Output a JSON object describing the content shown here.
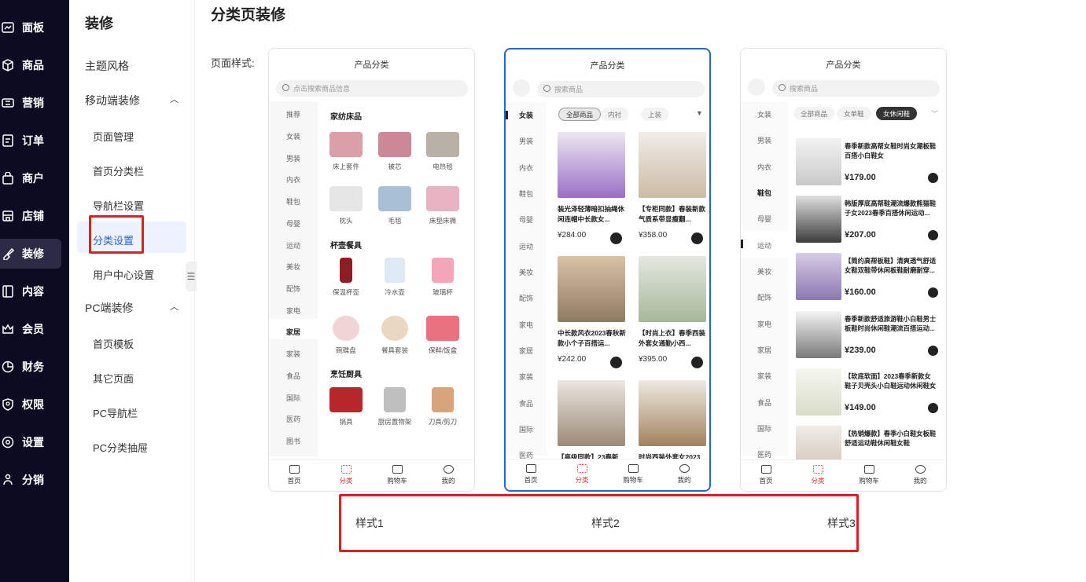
{
  "nav": {
    "items": [
      {
        "label": "面板",
        "icon": "chart-line-icon"
      },
      {
        "label": "商品",
        "icon": "box-icon"
      },
      {
        "label": "营销",
        "icon": "coupon-icon"
      },
      {
        "label": "订单",
        "icon": "order-list-icon"
      },
      {
        "label": "商户",
        "icon": "bag-icon"
      },
      {
        "label": "店铺",
        "icon": "store-icon"
      },
      {
        "label": "装修",
        "icon": "brush-icon"
      },
      {
        "label": "内容",
        "icon": "document-icon"
      },
      {
        "label": "会员",
        "icon": "crown-icon"
      },
      {
        "label": "财务",
        "icon": "pie-chart-icon"
      },
      {
        "label": "权限",
        "icon": "shield-icon"
      },
      {
        "label": "设置",
        "icon": "gear-icon"
      },
      {
        "label": "分销",
        "icon": "share-icon"
      }
    ],
    "active": "装修"
  },
  "sub": {
    "title": "装修",
    "theme": "主题风格",
    "mobile": "移动端装修",
    "mobile_children": [
      "页面管理",
      "首页分类栏",
      "导航栏设置",
      "分类设置",
      "用户中心设置"
    ],
    "pc": "PC端装修",
    "pc_children": [
      "首页模板",
      "其它页面",
      "PC导航栏",
      "PC分类抽屉"
    ]
  },
  "main": {
    "title": "分类页装修",
    "style_label": "页面样式:"
  },
  "phone1": {
    "title": "产品分类",
    "search_placeholder": "点击搜索商品信息",
    "cats": [
      "推荐",
      "女装",
      "男装",
      "内衣",
      "鞋包",
      "母婴",
      "运动",
      "美妆",
      "配饰",
      "家电",
      "家居",
      "家装",
      "食品",
      "国际",
      "医药",
      "图书"
    ],
    "active_cat": "家居",
    "sections": [
      {
        "title": "家纺床品",
        "items": [
          "床上套件",
          "被芯",
          "电热毯",
          "枕头",
          "毛毯",
          "床垫床褥"
        ]
      },
      {
        "title": "杯壶餐具",
        "items": [
          "保温杯壶",
          "冷水壶",
          "玻璃杯",
          "碗碟盘",
          "餐具套装",
          "保鲜/饭盒"
        ]
      },
      {
        "title": "烹饪厨具",
        "items": [
          "锅具",
          "厨房置物架",
          "刀具/剪刀"
        ]
      }
    ]
  },
  "phone2": {
    "title": "产品分类",
    "search_placeholder": "搜索商品",
    "cats": [
      "女装",
      "男装",
      "内衣",
      "鞋包",
      "母婴",
      "运动",
      "美妆",
      "配饰",
      "家电",
      "家居",
      "家装",
      "食品",
      "国际",
      "医药"
    ],
    "active_cat": "女装",
    "chips": [
      "全部商品",
      "内衬",
      "上装"
    ],
    "goods": [
      {
        "name": "装光泽轻薄暗扣抽绳休闲连帽中长款女...",
        "price": "¥284.00"
      },
      {
        "name": "【专柜同款】春装新款气质系带显瘦翻...",
        "price": "¥358.00"
      },
      {
        "name": "中长款风衣2023春秋新款小个子百搭运...",
        "price": "¥242.00"
      },
      {
        "name": "【时尚上衣】春季西装外套女通勤小西...",
        "price": "¥395.00"
      },
      {
        "name": "【高级同款】23春新",
        "price": ""
      },
      {
        "name": "时尚西装外套女2023",
        "price": ""
      }
    ]
  },
  "phone3": {
    "title": "产品分类",
    "search_placeholder": "搜索商品",
    "cats": [
      "女装",
      "男装",
      "内衣",
      "鞋包",
      "母婴",
      "运动",
      "美妆",
      "配饰",
      "家电",
      "家居",
      "家装",
      "食品",
      "国际",
      "医药"
    ],
    "active_cat": "鞋包",
    "chips": [
      "全部商品",
      "女单鞋",
      "女休闲鞋"
    ],
    "goods": [
      {
        "name": "春季新款高帮女鞋时尚女潮板鞋百搭小白鞋女",
        "price": "¥179.00"
      },
      {
        "name": "韩版厚底高帮鞋潮流爆款熊猫鞋子女2023春季百搭休闲运动...",
        "price": "¥207.00"
      },
      {
        "name": "【简约高帮板鞋】清爽透气舒适女鞋双鞋带休闲板鞋耐磨耐穿...",
        "price": "¥160.00"
      },
      {
        "name": "春季新款舒适旅游鞋小白鞋男士板鞋时尚休闲鞋潮流百搭运动...",
        "price": "¥239.00"
      },
      {
        "name": "【软底软面】2023春季新款女鞋子贝壳头小白鞋运动休闲鞋女",
        "price": "¥149.00"
      },
      {
        "name": "【热销爆款】春季小白鞋女板鞋舒适运动鞋休闲鞋女鞋",
        "price": ""
      }
    ]
  },
  "tabbar": [
    "首页",
    "分类",
    "购物车",
    "我的"
  ],
  "styles": [
    "样式1",
    "样式2",
    "样式3"
  ],
  "colors": {
    "accent": "#e5322d",
    "selected_border": "#2a63d8",
    "nav_bg": "#0b0b22",
    "highlight": "#e02020"
  }
}
